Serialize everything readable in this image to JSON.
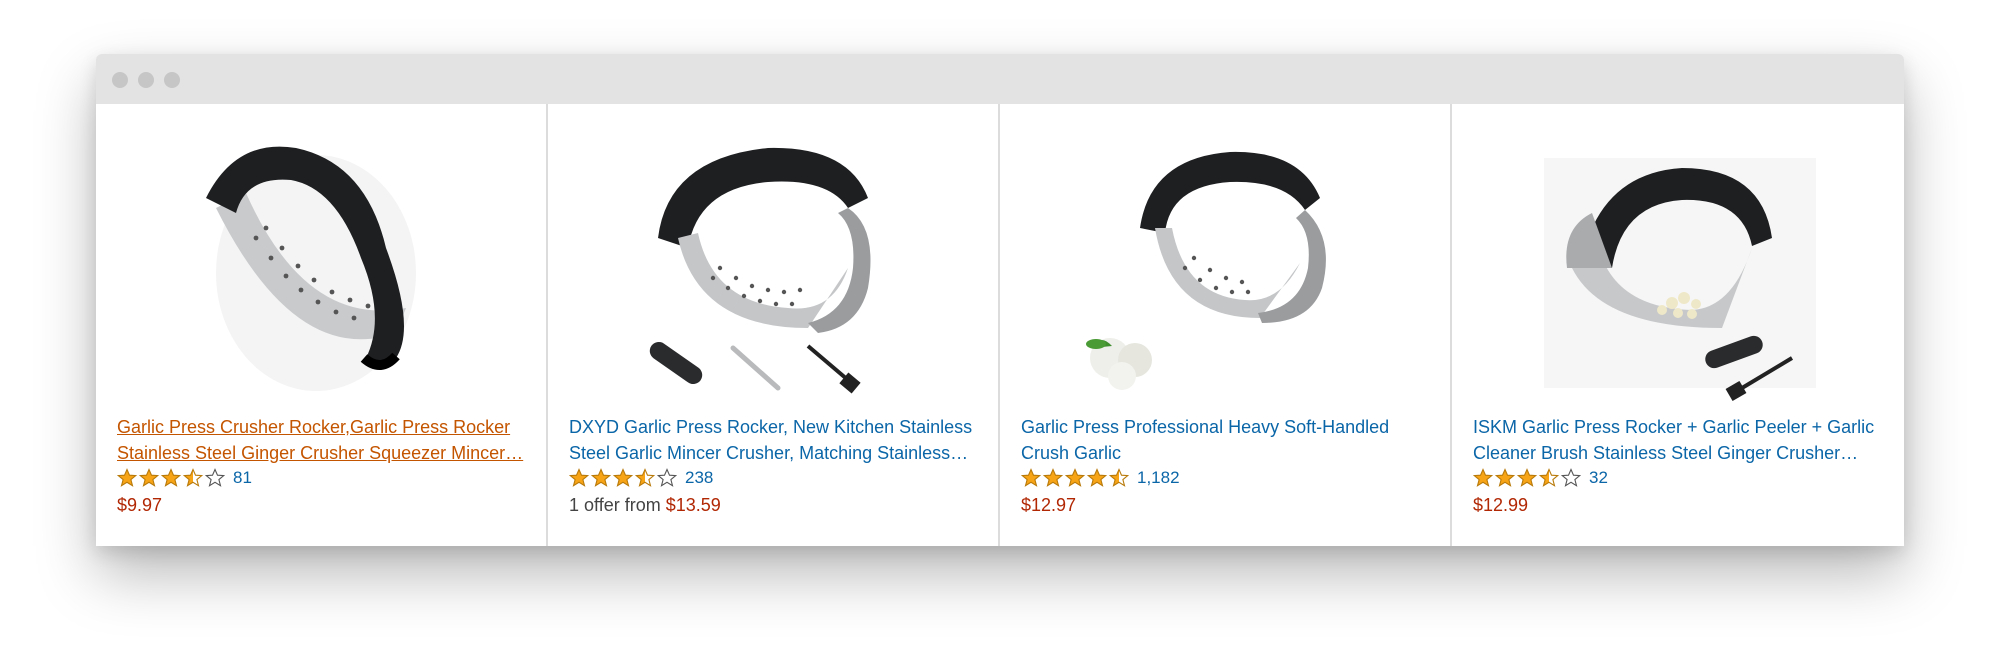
{
  "products": [
    {
      "title": "Garlic Press Crusher Rocker,Garlic Press Rocker Stainless Steel Ginger Crusher Squeezer Mincer…",
      "rating": 3.5,
      "review_count": "81",
      "price": "$9.97",
      "hover": true
    },
    {
      "title": "DXYD Garlic Press Rocker, New Kitchen Stainless Steel Garlic Mincer Crusher, Matching Stainless…",
      "rating": 3.5,
      "review_count": "238",
      "offer_prefix": "1 offer from ",
      "price": "$13.59",
      "hover": false
    },
    {
      "title": "Garlic Press Professional Heavy Soft-Handled Crush Garlic",
      "rating": 4.5,
      "review_count": "1,182",
      "price": "$12.97",
      "hover": false
    },
    {
      "title": "ISKM Garlic Press Rocker + Garlic Peeler + Garlic Cleaner Brush Stainless Steel Ginger Crusher…",
      "rating": 3.5,
      "review_count": "32",
      "price": "$12.99",
      "hover": false
    }
  ],
  "colors": {
    "link": "#0b66a8",
    "link_hover": "#c45500",
    "price": "#b12704",
    "star": "#f7a417"
  }
}
